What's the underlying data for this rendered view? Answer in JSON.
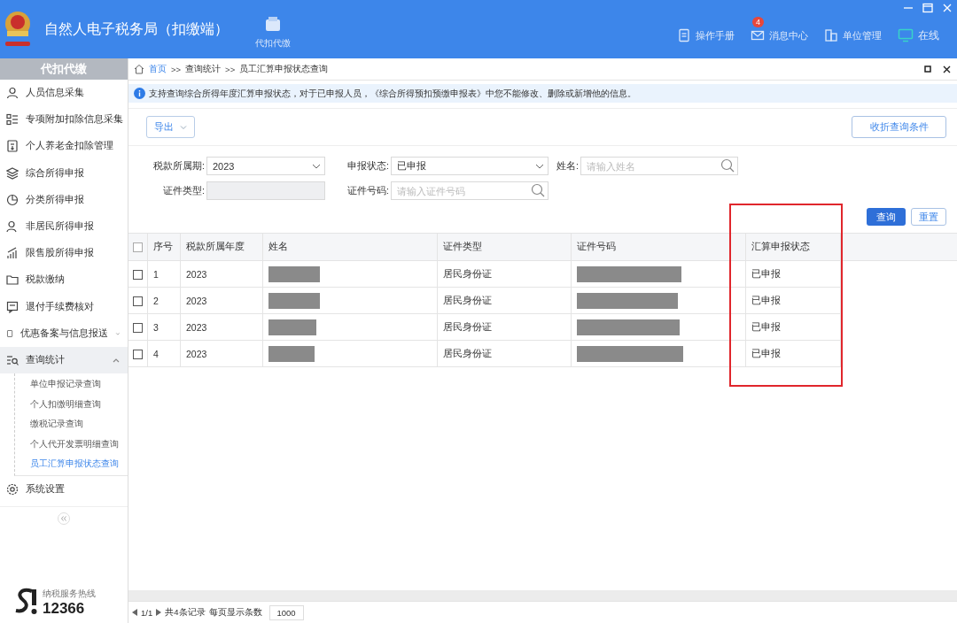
{
  "header": {
    "title": "自然人电子税务局（扣缴端）",
    "nav_item": "代扣代缴",
    "tools": [
      {
        "label": "操作手册"
      },
      {
        "label": "消息中心",
        "badge": "4"
      },
      {
        "label": "单位管理"
      }
    ],
    "status": "在线"
  },
  "sidebar": {
    "heading": "代扣代缴",
    "items": [
      {
        "label": "人员信息采集"
      },
      {
        "label": "专项附加扣除信息采集"
      },
      {
        "label": "个人养老金扣除管理"
      },
      {
        "label": "综合所得申报"
      },
      {
        "label": "分类所得申报"
      },
      {
        "label": "非居民所得申报"
      },
      {
        "label": "限售股所得申报"
      },
      {
        "label": "税款缴纳"
      },
      {
        "label": "退付手续费核对"
      },
      {
        "label": "优惠备案与信息报送",
        "expanded": false
      },
      {
        "label": "查询统计",
        "expanded": true,
        "children": [
          {
            "label": "单位申报记录查询",
            "selected": false
          },
          {
            "label": "个人扣缴明细查询",
            "selected": false
          },
          {
            "label": "缴税记录查询",
            "selected": false
          },
          {
            "label": "个人代开发票明细查询",
            "selected": false
          },
          {
            "label": "员工汇算申报状态查询",
            "selected": true
          }
        ]
      },
      {
        "label": "系统设置"
      }
    ],
    "hotline_label": "纳税服务热线",
    "hotline_number": "12366"
  },
  "breadcrumb": [
    "首页",
    "查询统计",
    "员工汇算申报状态查询"
  ],
  "breadcrumb_separator": ">>",
  "info": "支持查询综合所得年度汇算申报状态，对于已申报人员，《综合所得预扣预缴申报表》中您不能修改、删除或新增他的信息。",
  "export_button": "导出",
  "collapse_button": "收折查询条件",
  "filters": [
    [
      {
        "kind": "select",
        "label": "税款所属期:",
        "value": "2023"
      },
      {
        "kind": "select",
        "label": "申报状态:",
        "value": "已申报"
      },
      {
        "kind": "search",
        "label": "姓名:",
        "placeholder": "请输入姓名"
      }
    ],
    [
      {
        "kind": "disabled",
        "label": "证件类型:"
      },
      {
        "kind": "search",
        "label": "证件号码:",
        "placeholder": "请输入证件号码"
      }
    ]
  ],
  "query_button": "查询",
  "reset_button": "重置",
  "table": {
    "select_all_checked": false,
    "columns": [
      "序号",
      "税款所属年度",
      "姓名",
      "证件类型",
      "证件号码",
      "汇算申报状态"
    ],
    "rows": [
      {
        "checked": false,
        "index": "1",
        "year": "2023",
        "id_type": "居民身份证",
        "status": "已申报"
      },
      {
        "checked": false,
        "index": "2",
        "year": "2023",
        "id_type": "居民身份证",
        "status": "已申报"
      },
      {
        "checked": false,
        "index": "3",
        "year": "2023",
        "id_type": "居民身份证",
        "status": "已申报"
      },
      {
        "checked": false,
        "index": "4",
        "year": "2023",
        "id_type": "居民身份证",
        "status": "已申报"
      }
    ]
  },
  "pagination": {
    "page": "1/1",
    "total": "共4条记录",
    "per_page_label": "每页显示条数",
    "per_page": "1000"
  }
}
